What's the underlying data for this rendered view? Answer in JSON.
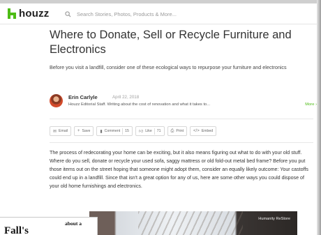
{
  "header": {
    "logo_text": "houzz",
    "search_placeholder": "Search Stories, Photos, Products & More..."
  },
  "article": {
    "title": "Where to Donate, Sell or Recycle Furniture and Electronics",
    "subtitle": "Before you visit a landfill, consider one of these ecological ways to repurpose your furniture and electronics",
    "author": {
      "name": "Erin Carlyle",
      "date": "April 22, 2018",
      "bio": "Houzz Editorial Staff. Writing about the cost of renovation and what it takes to...",
      "more_label": "More ›"
    },
    "actions": {
      "email": "Email",
      "save": "Save",
      "comment": "Comment",
      "comment_count": "15",
      "like": "Like",
      "like_count": "71",
      "print": "Print",
      "embed": "Embed"
    },
    "body": "The process of redecorating your home can be exciting, but it also means figuring out what to do with your old stuff. Where do you sell, donate or recycle your used sofa, saggy mattress or old fold-out metal bed frame? Before you put those items out on the street hoping that someone might adopt them, consider an equally likely outcome: Your castoffs could end up in a landfill. Since that isn't a great option for any of us, here are some other ways you could dispose of your old home furnishings and electronics.",
    "photo_credit": "Humanity ReStore"
  },
  "paper_scrap": {
    "left_text": "Fall's",
    "mid_text": "about a"
  },
  "colors": {
    "brand_green": "#4dbc15"
  },
  "icons": {
    "logo": "houzz-logo-icon",
    "search": "search-icon",
    "email": "email-icon",
    "save": "plus-icon",
    "comment": "comment-icon",
    "like": "thumbs-up-icon",
    "print": "print-icon",
    "embed": "embed-icon"
  }
}
